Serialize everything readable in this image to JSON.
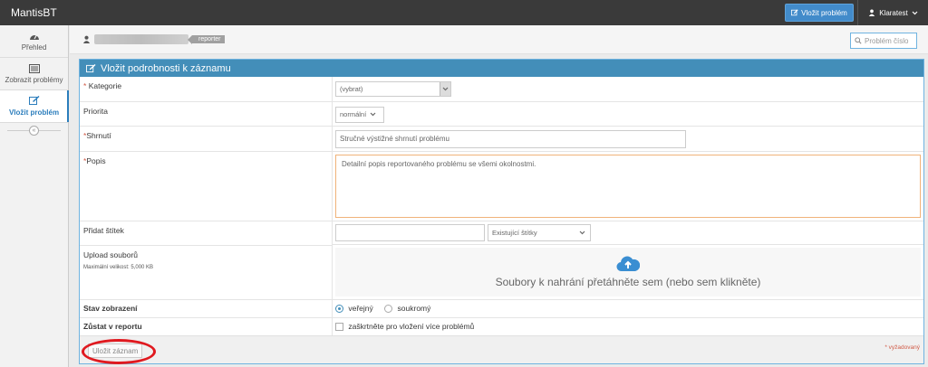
{
  "navbar": {
    "brand": "MantisBT",
    "report_button": "Vložit problém",
    "user_menu": "Klaratest"
  },
  "sidebar": {
    "items": [
      {
        "label": "Přehled",
        "icon": "dashboard-icon"
      },
      {
        "label": "Zobrazit problémy",
        "icon": "list-icon"
      },
      {
        "label": "Vložit problém",
        "icon": "edit-icon",
        "active": true
      }
    ]
  },
  "breadcrumb": {
    "role": "reporter"
  },
  "search": {
    "placeholder": "Problém číslo"
  },
  "form": {
    "title": "Vložit podrobnosti k záznamu",
    "fields": {
      "category": {
        "label": "Kategorie",
        "required": "*",
        "value": "(vybrat)"
      },
      "priority": {
        "label": "Priorita",
        "value": "normální"
      },
      "summary": {
        "label": "Shrnutí",
        "required": "*",
        "placeholder": "Stručné výstižné shrnutí problému"
      },
      "description": {
        "label": "Popis",
        "required": "*",
        "placeholder": "Detailní popis reportovaného problému se všemi okolnostmi."
      },
      "tag": {
        "label": "Přidat štítek",
        "existing": "Existující štítky"
      },
      "upload": {
        "label": "Upload souborů",
        "note": "Maximální velikost: 5,000 KB",
        "dropzone_text": "Soubory k nahrání přetáhněte sem (nebo sem klikněte)"
      },
      "visibility": {
        "label": "Stav zobrazení",
        "public": "veřejný",
        "private": "soukromý"
      },
      "stay": {
        "label": "Zůstat v reportu",
        "checkbox_label": "zaškrtněte pro vložení více problémů"
      }
    },
    "submit": "Uložit záznam",
    "required_note": "* vyžadovaný"
  },
  "colors": {
    "navbar": "#3a3a3a",
    "accent": "#438eb9",
    "highlight_oval": "#e0191f"
  }
}
